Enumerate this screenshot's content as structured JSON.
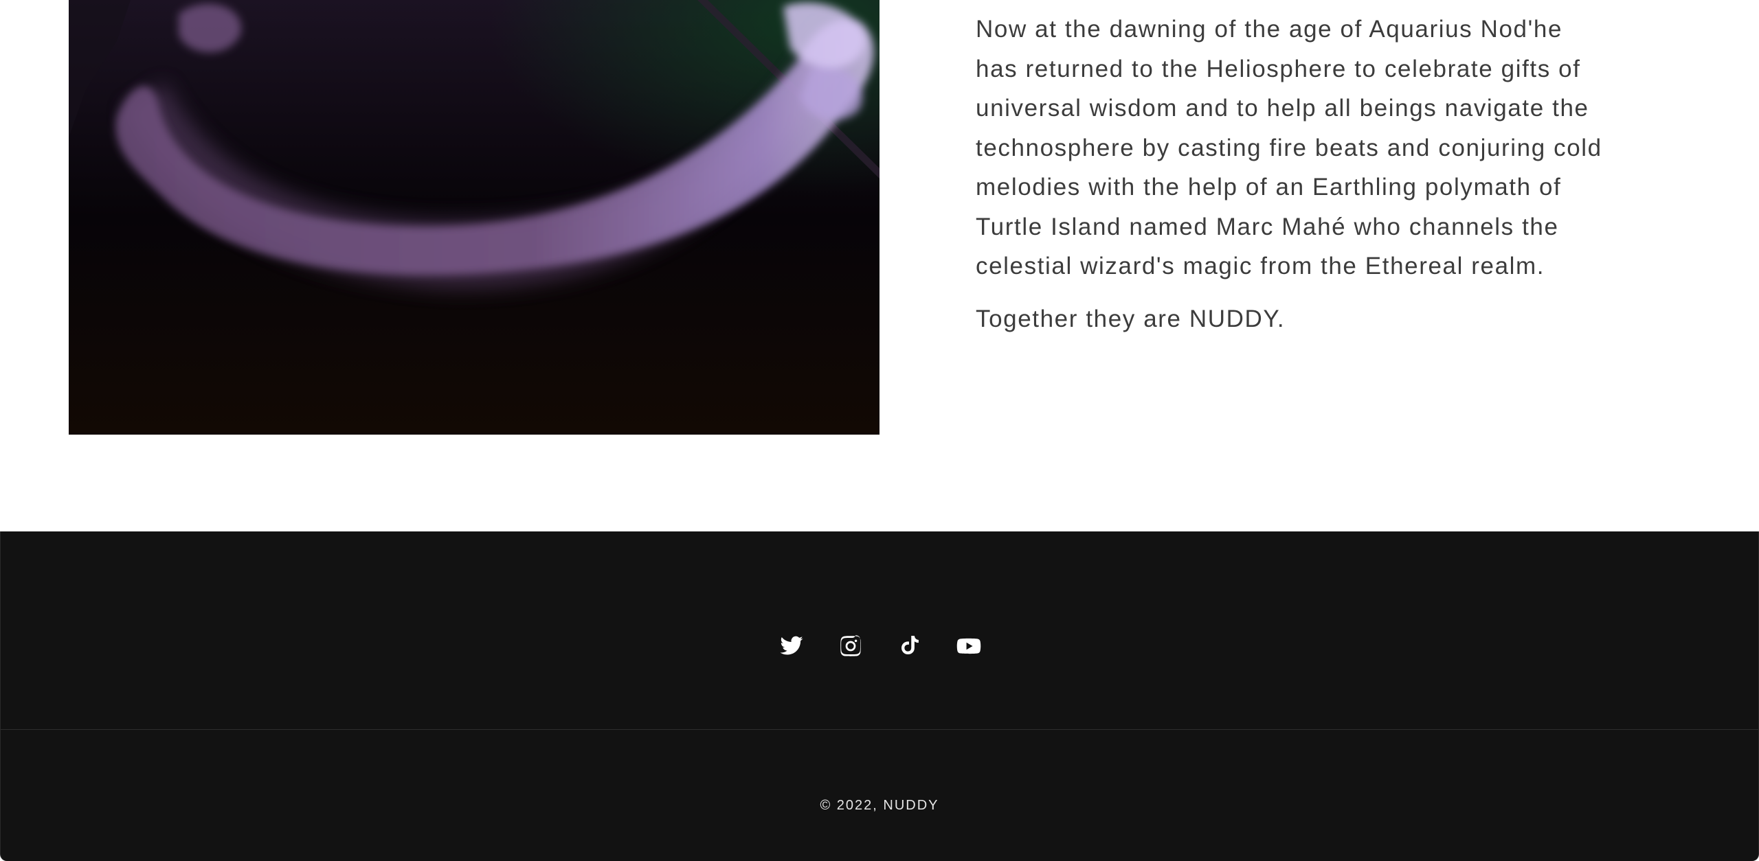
{
  "about": {
    "paragraphs": [
      "Now at the dawning of the age of Aquarius Nod'he has returned to the Heliosphere to celebrate gifts of universal wisdom and to help all beings navigate the technosphere by casting fire beats and conjuring cold melodies with the help of an Earthling polymath of Turtle Island named Marc Mahé who channels the celestial wizard's magic from the Ethereal realm.",
      "Together they are NUDDY."
    ]
  },
  "footer": {
    "social": [
      {
        "name": "Twitter",
        "icon": "twitter-icon"
      },
      {
        "name": "Instagram",
        "icon": "instagram-icon"
      },
      {
        "name": "TikTok",
        "icon": "tiktok-icon"
      },
      {
        "name": "YouTube",
        "icon": "youtube-icon"
      }
    ],
    "copyright": "© 2022, NUDDY"
  },
  "colors": {
    "footer_bg": "#121212",
    "text": "#3c3c3c",
    "cloud": "#b49ad6"
  }
}
